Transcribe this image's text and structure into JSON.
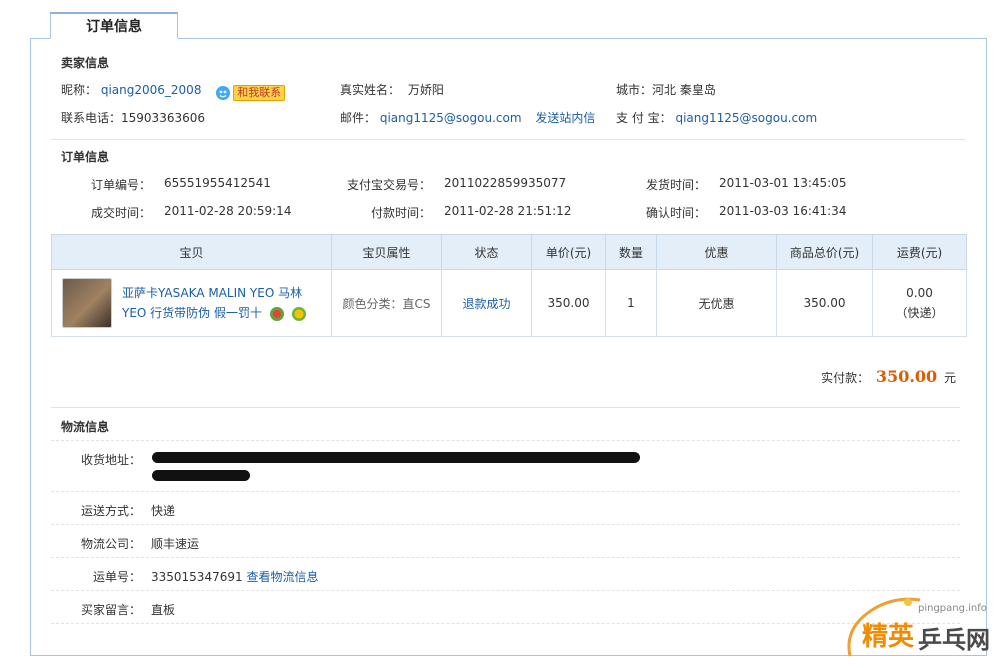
{
  "tab": {
    "label": "订单信息"
  },
  "seller": {
    "title": "卖家信息",
    "nick_label": "昵称：",
    "nick": "qiang2006_2008",
    "chat_badge": "和我联系",
    "realname_label": "真实姓名：",
    "realname": "万娇阳",
    "city_label": "城市：",
    "city": "河北 秦皇岛",
    "phone_label": "联系电话：",
    "phone": "15903363606",
    "email_label": "邮件：",
    "email": "qiang1125@sogou.com",
    "send_msg": "发送站内信",
    "alipay_label": "支 付 宝：",
    "alipay": "qiang1125@sogou.com"
  },
  "order": {
    "title": "订单信息",
    "no_label": "订单编号：",
    "no": "65551955412541",
    "alipay_no_label": "支付宝交易号：",
    "alipay_no": "2011022859935077",
    "ship_time_label": "发货时间：",
    "ship_time": "2011-03-01 13:45:05",
    "deal_time_label": "成交时间：",
    "deal_time": "2011-02-28 20:59:14",
    "pay_time_label": "付款时间：",
    "pay_time": "2011-02-28 21:51:12",
    "confirm_time_label": "确认时间：",
    "confirm_time": "2011-03-03 16:41:34"
  },
  "table": {
    "headers": [
      "宝贝",
      "宝贝属性",
      "状态",
      "单价(元)",
      "数量",
      "优惠",
      "商品总价(元)",
      "运费(元)"
    ],
    "row": {
      "title_line1": "亚萨卡YASAKA MALIN YEO 马林",
      "title_line2": "YEO 行货带防伪 假一罚十",
      "attr": "颜色分类：直CS",
      "status": "退款成功",
      "price": "350.00",
      "qty": "1",
      "discount": "无优惠",
      "total": "350.00",
      "shipping": "0.00",
      "shipping_method": "（快递）"
    }
  },
  "payment": {
    "label": "实付款：",
    "amount": "350.00",
    "unit": "元"
  },
  "logistics": {
    "title": "物流信息",
    "address_label": "收货地址：",
    "method_label": "运送方式：",
    "method": "快递",
    "company_label": "物流公司：",
    "company": "顺丰速运",
    "waybill_label": "运单号：",
    "waybill": "335015347691",
    "track_link": "查看物流信息",
    "message_label": "买家留言：",
    "message": "直板"
  },
  "watermark": {
    "site": "pingpang.info",
    "brand_left": "精英",
    "brand_right": "乒乓网"
  },
  "colors": {
    "accent": "#1a5ea8",
    "price": "#e05a00",
    "border": "#a9c4de",
    "header_bg": "#e3eef9"
  }
}
